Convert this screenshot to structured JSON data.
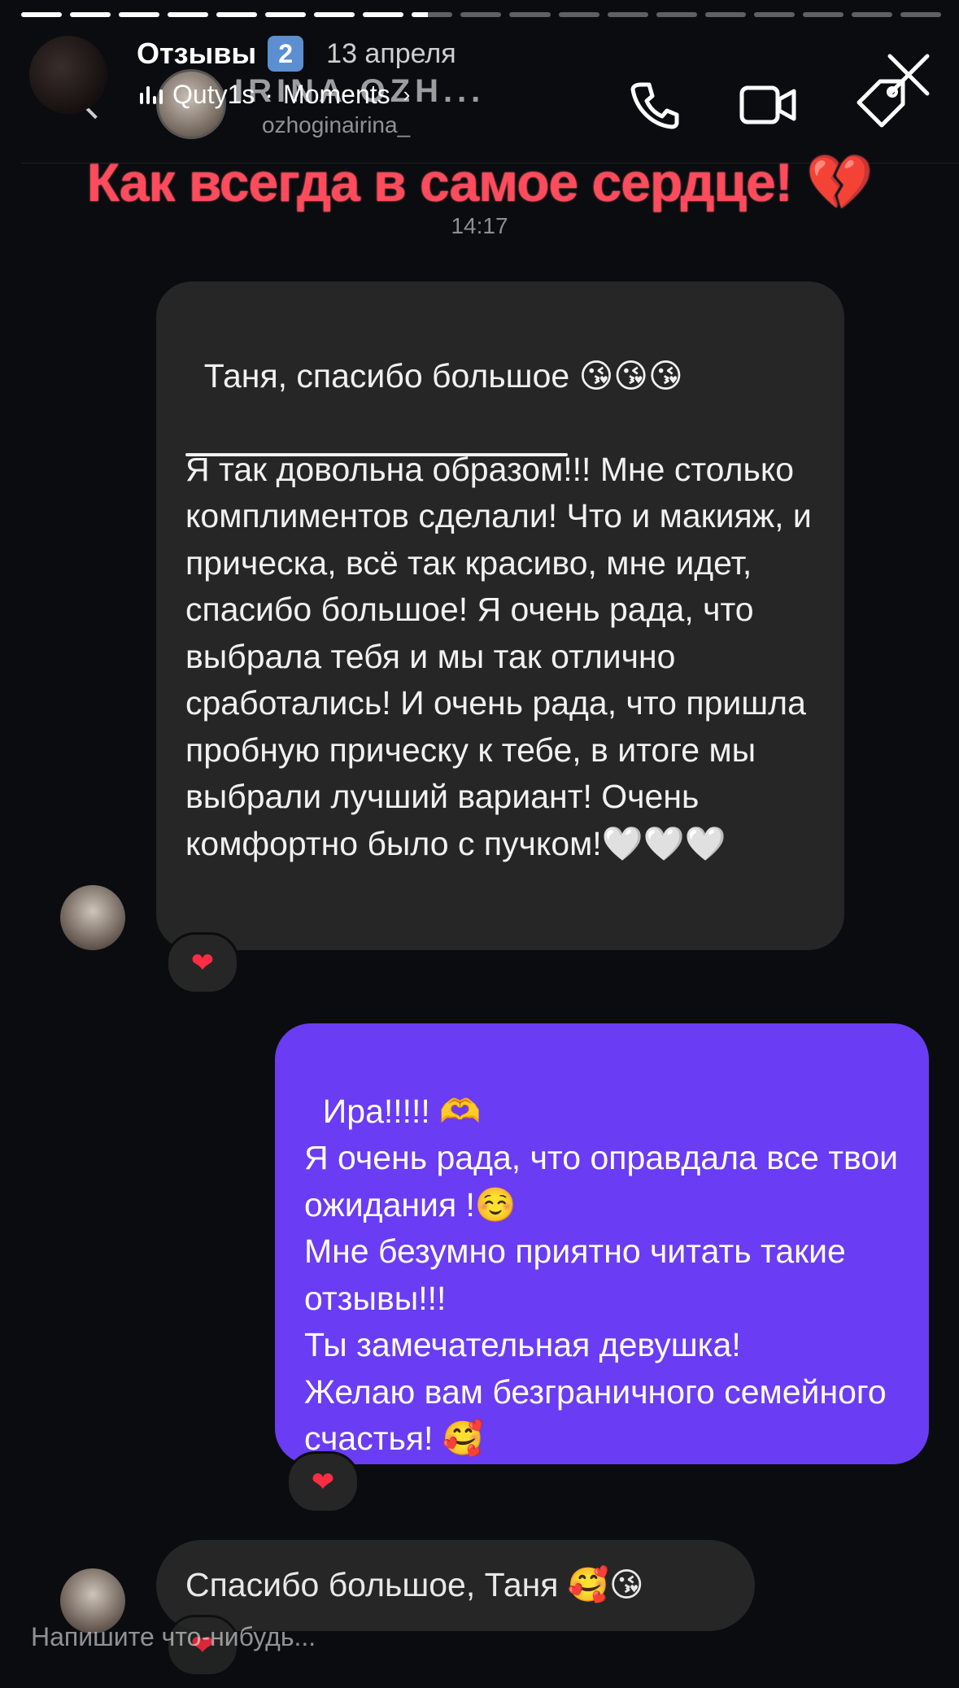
{
  "story": {
    "title": "Отзывы",
    "badge": "2",
    "date": "13 апреля",
    "music": "Quty1s",
    "separator": "·",
    "moments": "Moments",
    "chevron": "›",
    "progress_segments": [
      1,
      1,
      1,
      1,
      1,
      1,
      1,
      1,
      0.4,
      0,
      0,
      0,
      0,
      0,
      0,
      0,
      0,
      0,
      0
    ]
  },
  "dm_header": {
    "name": "IRINA OZH...",
    "username": "ozhoginairina_",
    "icons": [
      "back-chevron-icon",
      "phone-icon",
      "video-icon",
      "tag-icon"
    ]
  },
  "sticker": "Как всегда в самое сердце! 💔",
  "time": "14:17",
  "messages": [
    {
      "from": "other",
      "text": "Таня, спасибо большое 😘😘😘\n\nЯ так довольна образом!!! Мне столько комплиментов сделали! Что и макияж, и прическа, всё так красиво, мне идет, спасибо большое! Я очень рада, что выбрала тебя и мы так отлично сработались! И очень рада, что пришла пробную прическу к тебе, в итоге мы выбрали лучший вариант! Очень комфортно было с пучком!🤍🤍🤍",
      "reaction": "❤"
    },
    {
      "from": "me",
      "text": "Ира!!!!! 🫶\nЯ очень рада, что оправдала все твои ожидания !☺️\nМне безумно приятно читать такие отзывы!!!\nТы замечательная девушка!\nЖелаю вам безграничного семейного счастья! 🥰",
      "reaction": "❤"
    },
    {
      "from": "other",
      "text": "Спасибо большое, Таня 🥰😘",
      "reaction": "❤"
    }
  ],
  "footer": {
    "placeholder": "Напишите что-нибудь..."
  }
}
